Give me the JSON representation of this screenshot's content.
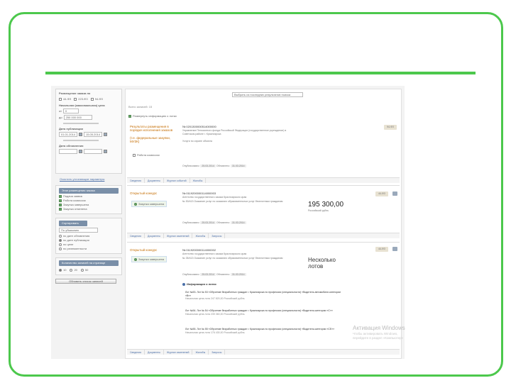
{
  "sidebar": {
    "filters_title": "Размещение заказа по",
    "laws": [
      "44-ФЗ",
      "223-ФЗ",
      "94-ФЗ"
    ],
    "price_label": "Начальная (максимальная) цена",
    "price_from_label": "от",
    "price_from": "0",
    "price_to_label": "до",
    "price_to": "250 000 000",
    "publish_date_label": "Дата публикации",
    "publish_from": "01.01.2014",
    "publish_to": "15.05.2014",
    "update_date_label": "Дата обновления",
    "clear_button": "Очистить уточняющие параметры",
    "stages_title": "Этап размещения заказа",
    "stages": [
      {
        "label": "Подача заявок",
        "checked": true
      },
      {
        "label": "Работа комиссии",
        "checked": true
      },
      {
        "label": "Закупка завершена",
        "checked": true
      },
      {
        "label": "Закупка отменена",
        "checked": true
      }
    ],
    "sort_title": "Сортировать",
    "sort_select": "По убыванию",
    "sort_options": [
      {
        "label": "по дате обновления",
        "checked": false
      },
      {
        "label": "по дате публикации",
        "checked": true
      },
      {
        "label": "по цене",
        "checked": false
      },
      {
        "label": "по релевантности",
        "checked": false
      }
    ],
    "per_page_title": "Количество записей на странице",
    "per_page_options": [
      "10",
      "20",
      "50"
    ],
    "refresh_button": "Обновить список записей"
  },
  "main": {
    "search_placeholder": "Выбрать из последних результатов поиска",
    "found_label": "Всего записей: 15",
    "checkbox_label": "Развернуть информацию о лотах",
    "cards": [
      {
        "status": "Результаты размещения в порядке исполнения заказов",
        "status_sub": "(т.е. федеральные закупки, МУЗК)",
        "number": "№ 0201300000514000000",
        "org": "Управление Пенсионного фонда Российской Федерации (государственное учреждение) в Советском районе г. Красноярска",
        "subject": "Услуги по охране объекта",
        "check_label": "Работа комиссии",
        "tag": "94-ФЗ",
        "published_label": "Опубликовано:",
        "published": "25.03.2014",
        "updated_label": "Обновлено:",
        "updated": "31.03.2014",
        "tabs": [
          "Сведения",
          "Документы",
          "Журнал событий",
          "Жалобы"
        ]
      },
      {
        "status": "Открытый конкурс",
        "number": "№ 0119200000114000003",
        "org": "Агентство государственного заказа Красноярского края",
        "subject": "№ 53/413 Оказание услуг по оказанию образовательных услуг бесплатным гражданам",
        "check_label": "Закупка завершена",
        "tag": "44-ФЗ",
        "price": "195 300,00",
        "currency": "Российский рубль",
        "published_label": "Опубликовано:",
        "published": "25.03.2014",
        "updated_label": "Обновлено:",
        "updated": "31.03.2014",
        "tabs": [
          "Сведения",
          "Документы",
          "Журнал изменений",
          "Жалобы",
          "Запросы"
        ]
      },
      {
        "status": "Открытый конкурс",
        "number": "№ 0119200000114000002",
        "org": "Агентство государственного заказа Красноярского края",
        "subject": "№ 35/413 Оказание услуг по оказанию образовательных услуг бесплатным гражданам",
        "check_label": "Закупка завершена",
        "tag": "44-ФЗ",
        "multi": "Несколько лотов",
        "published_label": "Опубликовано:",
        "published": "25.03.2014",
        "updated_label": "Обновлено:",
        "updated": "31.03.2014",
        "lots_title": "Информация о лотах",
        "lots": [
          {
            "title": "Лот №53. Лот № 53 «Обучение безработных граждан г. Красноярска по профессии (специальности) «Водитель автомобиля категории «B»»",
            "sub": "Начальная цена лота 247 820,00 Российский рубль"
          },
          {
            "title": "Лот №54. Лот № 54 «Обучение безработных граждан г. Красноярска по профессии (специальности) «Водитель категории «C»»",
            "sub": "Начальная цена лота 239 360,00 Российский рубль"
          },
          {
            "title": "Лот №55. Лот № 55 «Обучение безработных граждан г. Красноярска по профессии (специальности) «Водитель категории «CE»»",
            "sub": "Начальная цена лота 176 430,00 Российский рубль"
          }
        ],
        "tabs": [
          "Сведения",
          "Документы",
          "Журнал изменений",
          "Жалобы",
          "Запросы"
        ]
      }
    ]
  },
  "watermark": {
    "title": "Активация Windows",
    "sub": "Чтобы активировать Windows, перейдите в раздел «Компьютер»"
  }
}
